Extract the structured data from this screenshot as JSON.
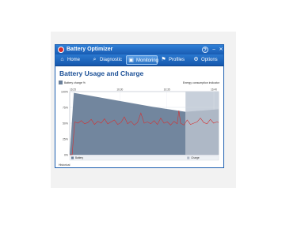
{
  "window": {
    "title": "Battery Optimizer"
  },
  "nav": {
    "tabs": [
      {
        "label": "Home",
        "icon": "home-icon"
      },
      {
        "label": "Diagnostic",
        "icon": "magnifier-icon"
      },
      {
        "label": "Monitoring",
        "icon": "monitor-icon"
      },
      {
        "label": "Profiles",
        "icon": "profiles-icon"
      },
      {
        "label": "Options",
        "icon": "gear-icon"
      }
    ],
    "active": "Monitoring"
  },
  "page": {
    "heading": "Battery Usage and Charge",
    "legend_left": "Battery charge %",
    "legend_right": "Energy consumption indicator",
    "bottom_label": "Historical"
  },
  "colors": {
    "charge_area": "#6a7f99",
    "charge_area_light": "#c8d0db",
    "usage_line": "#d53030",
    "title_accent": "#1a4f96"
  },
  "chart_data": {
    "type": "area",
    "title": "",
    "ylim": [
      0,
      100
    ],
    "yticks": [
      "100",
      "75",
      "50",
      "25",
      "0"
    ],
    "xticks": [
      "16:25",
      "16:30",
      "16:35",
      "16:40"
    ],
    "series": [
      {
        "name": "Battery",
        "kind": "area",
        "x": [
          0,
          0.05,
          1,
          1.4,
          1.8
        ],
        "values": [
          0,
          98,
          76,
          68,
          72
        ]
      },
      {
        "name": "Charge",
        "kind": "line",
        "x": [
          0,
          0.03,
          0.06,
          0.1,
          0.14,
          0.18,
          0.22,
          0.26,
          0.3,
          0.34,
          0.38,
          0.42,
          0.46,
          0.5,
          0.54,
          0.58,
          0.62,
          0.66,
          0.7,
          0.74,
          0.78,
          0.82,
          0.86,
          0.9,
          0.94,
          0.98,
          1.02,
          1.06,
          1.1,
          1.14,
          1.18,
          1.22,
          1.26,
          1.3,
          1.32,
          1.34,
          1.38,
          1.42,
          1.46,
          1.5,
          1.54,
          1.58,
          1.62,
          1.66,
          1.7,
          1.74,
          1.78,
          1.8
        ],
        "values": [
          0,
          0,
          52,
          50,
          54,
          49,
          51,
          56,
          48,
          53,
          50,
          57,
          49,
          52,
          55,
          48,
          51,
          60,
          49,
          53,
          47,
          51,
          66,
          50,
          52,
          49,
          54,
          48,
          58,
          50,
          52,
          47,
          53,
          49,
          70,
          50,
          47,
          55,
          48,
          50,
          52,
          58,
          51,
          49,
          56,
          50,
          52,
          51
        ]
      }
    ],
    "legend": [
      "Battery",
      "Charge"
    ],
    "grid": true
  }
}
